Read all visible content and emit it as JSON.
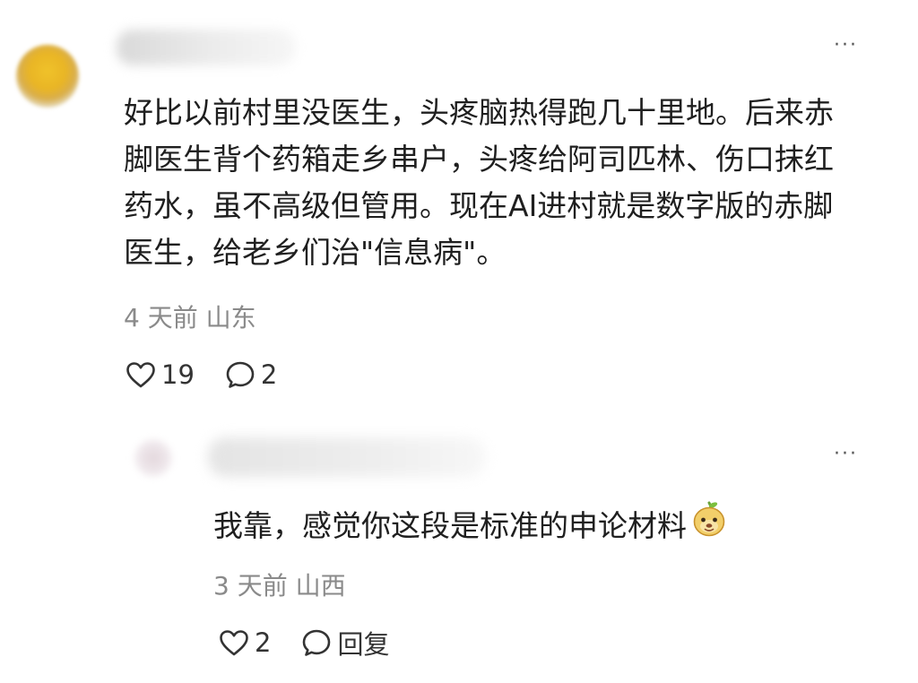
{
  "comments": [
    {
      "text": "好比以前村里没医生，头疼脑热得跑几十里地。后来赤脚医生背个药箱走乡串户，头疼给阿司匹林、伤口抹红药水，虽不高级但管用。现在AI进村就是数字版的赤脚医生，给老乡们治\"信息病\"。",
      "time": "4 天前",
      "location": "山东",
      "likes": "19",
      "replies": "2",
      "more": "···"
    },
    {
      "text": "我靠，感觉你这段是标准的申论材料",
      "emoji": "melon-face-emoji",
      "time": "3 天前",
      "location": "山西",
      "likes": "2",
      "reply_label": "回复",
      "more": "···"
    }
  ],
  "icons": {
    "like": "heart-outline-icon",
    "comment": "speech-bubble-icon"
  },
  "colors": {
    "text": "#1f1f1f",
    "meta": "#8a8a8a"
  }
}
